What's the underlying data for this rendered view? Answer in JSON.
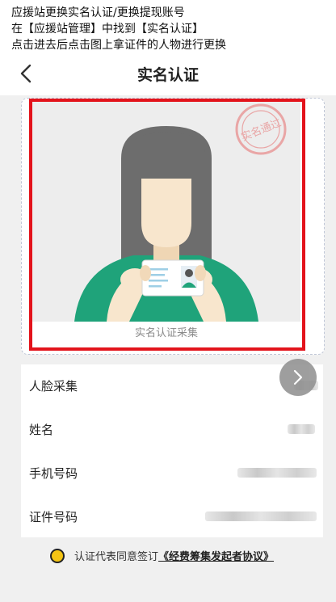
{
  "caption": {
    "line1": "应援站更换实名认证/更换提现账号",
    "line2": "在【应援站管理】中找到【实名认证】",
    "line3": "点击进去后点击图上拿证件的人物进行更换"
  },
  "nav": {
    "title": "实名认证",
    "back_icon": "chevron-left-icon"
  },
  "illustration": {
    "caption": "实名认证采集",
    "stamp_text": "实名通过",
    "colors": {
      "hair": "#6d6d6d",
      "shirt": "#1fa37a",
      "skin": "#f8e6cd",
      "stamp": "#e9a6a6",
      "highlight": "#e3131b"
    }
  },
  "form": {
    "rows": [
      {
        "label": "人脸采集"
      },
      {
        "label": "姓名"
      },
      {
        "label": "手机号码"
      },
      {
        "label": "证件号码"
      }
    ]
  },
  "agreement": {
    "prefix": "认证代表同意签订",
    "link": "《经费筹集发起者协议》",
    "checkbox_color": "#f4c414"
  }
}
